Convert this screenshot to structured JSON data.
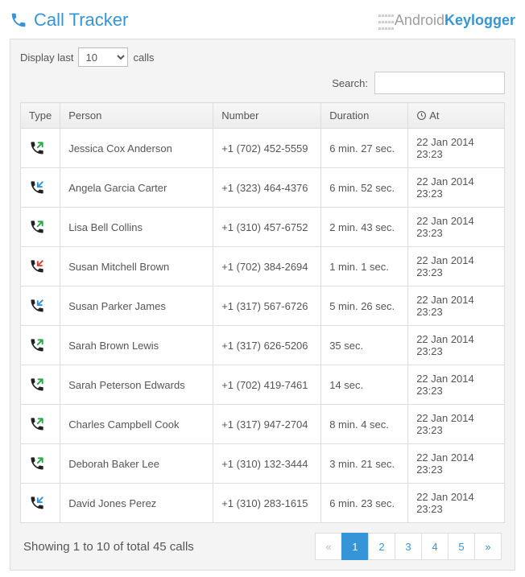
{
  "header": {
    "title": "Call Tracker",
    "brand1": "Android",
    "brand2": "Keylogger"
  },
  "controls": {
    "display_last": "Display last",
    "calls": "calls",
    "count_selected": "10",
    "search_label": "Search:"
  },
  "columns": {
    "type": "Type",
    "person": "Person",
    "number": "Number",
    "duration": "Duration",
    "at": "At"
  },
  "rows": [
    {
      "type": "outgoing",
      "person": "Jessica Cox Anderson",
      "number": "+1 (702) 452-5559",
      "duration": "6 min. 27 sec.",
      "at": "22 Jan 2014 23:23"
    },
    {
      "type": "incoming",
      "person": "Angela Garcia Carter",
      "number": "+1 (323) 464-4376",
      "duration": "6 min. 52 sec.",
      "at": "22 Jan 2014 23:23"
    },
    {
      "type": "outgoing",
      "person": "Lisa Bell Collins",
      "number": "+1 (310) 457-6752",
      "duration": "2 min. 43 sec.",
      "at": "22 Jan 2014 23:23"
    },
    {
      "type": "missed",
      "person": "Susan Mitchell Brown",
      "number": "+1 (702) 384-2694",
      "duration": "1 min. 1 sec.",
      "at": "22 Jan 2014 23:23"
    },
    {
      "type": "incoming",
      "person": "Susan Parker James",
      "number": "+1 (317) 567-6726",
      "duration": "5 min. 26 sec.",
      "at": "22 Jan 2014 23:23"
    },
    {
      "type": "outgoing",
      "person": "Sarah Brown Lewis",
      "number": "+1 (317) 626-5206",
      "duration": "35 sec.",
      "at": "22 Jan 2014 23:23"
    },
    {
      "type": "outgoing",
      "person": "Sarah Peterson Edwards",
      "number": "+1 (702) 419-7461",
      "duration": "14 sec.",
      "at": "22 Jan 2014 23:23"
    },
    {
      "type": "outgoing",
      "person": "Charles Campbell Cook",
      "number": "+1 (317) 947-2704",
      "duration": "8 min. 4 sec.",
      "at": "22 Jan 2014 23:23"
    },
    {
      "type": "outgoing",
      "person": "Deborah Baker Lee",
      "number": "+1 (310) 132-3444",
      "duration": "3 min. 21 sec.",
      "at": "22 Jan 2014 23:23"
    },
    {
      "type": "incoming",
      "person": "David Jones Perez",
      "number": "+1 (310) 283-1615",
      "duration": "6 min. 23 sec.",
      "at": "22 Jan 2014 23:23"
    }
  ],
  "footer": {
    "status": "Showing 1 to 10 of total 45 calls"
  },
  "pager": {
    "prev": "«",
    "next": "»",
    "pages": [
      "1",
      "2",
      "3",
      "4",
      "5"
    ],
    "active": 1
  },
  "colors": {
    "accent": "#3595d6",
    "outgoing": "#2aa94a",
    "incoming": "#3595d6",
    "missed": "#d9453a"
  }
}
